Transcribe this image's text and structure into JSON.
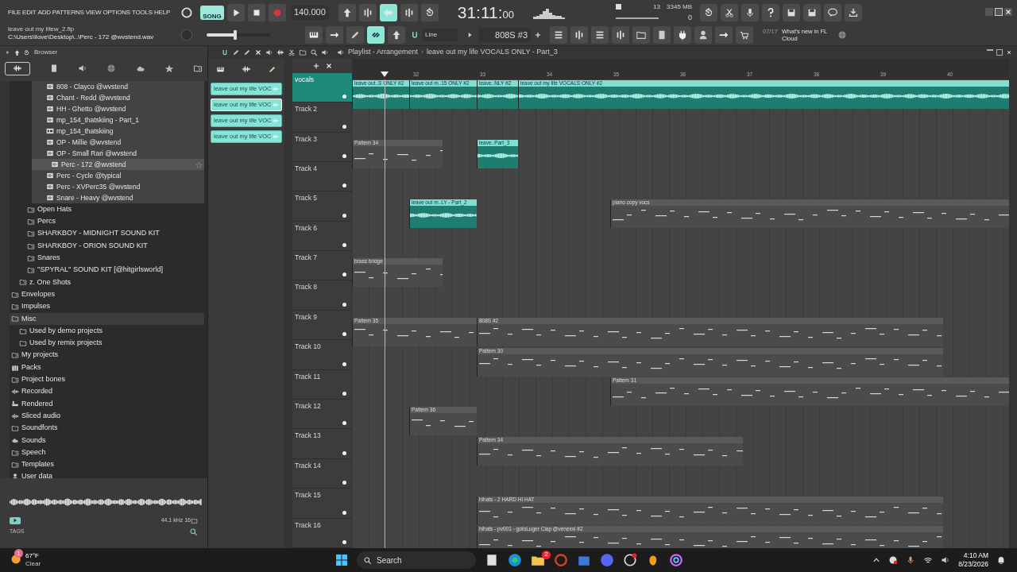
{
  "menu": [
    "FILE",
    "EDIT",
    "ADD",
    "PATTERNS",
    "VIEW",
    "OPTIONS",
    "TOOLS",
    "HELP"
  ],
  "hint": {
    "title": "leave out my lifew_2.flp",
    "path": "C:\\Users\\ilove\\Desktop\\..\\Perc - 172 @wvstend.wav"
  },
  "transport": {
    "mode": "SONG",
    "tempo": "140.000"
  },
  "master_volume": {
    "level": 0.45
  },
  "time": {
    "main": "31:11:",
    "sub": "00"
  },
  "memory": {
    "voices": "13",
    "ram": "3345 MB",
    "cpu": "0"
  },
  "snap": "Line",
  "pattern": "808S #3",
  "news": {
    "count": "07/17",
    "text": "What's new in FL Cloud"
  },
  "browser": {
    "title": "Browser",
    "files": [
      {
        "label": "808 - Clayco @wvstend",
        "kind": "audio",
        "selected": false
      },
      {
        "label": "Chant - Redd @wvstend",
        "kind": "audio",
        "selected": false
      },
      {
        "label": "HH - Ghetto @wvstend",
        "kind": "audio",
        "selected": false
      },
      {
        "label": "mp_154_thatskiing - Part_1",
        "kind": "audio",
        "selected": false
      },
      {
        "label": "mp_154_thatskiing",
        "kind": "mp3",
        "selected": false
      },
      {
        "label": "OP - Millie @wvstend",
        "kind": "audio",
        "selected": false
      },
      {
        "label": "OP - Small Rari @wvstend",
        "kind": "audio",
        "selected": false
      },
      {
        "label": "Perc - 172 @wvstend",
        "kind": "audio",
        "selected": true
      },
      {
        "label": "Perc - Cycle @typical",
        "kind": "audio",
        "selected": false
      },
      {
        "label": "Perc - XVPerc35 @wvstend",
        "kind": "audio",
        "selected": false
      },
      {
        "label": "Snare - Heavy @wvstend",
        "kind": "audio",
        "selected": false
      }
    ],
    "subfolders": [
      "Open Hats",
      "Percs",
      "SHARKBOY - MIDNIGHT SOUND KIT",
      "SHARKBOY - ORION SOUND KIT",
      "Snares",
      "''SPYRAL'' SOUND KIT [@hitgirlsworld]"
    ],
    "outer_folders": [
      "z. One Shots"
    ],
    "items": [
      {
        "label": "Envelopes",
        "kind": "link",
        "highlighted": false
      },
      {
        "label": "Impulses",
        "kind": "link",
        "highlighted": false
      },
      {
        "label": "Misc",
        "kind": "folder",
        "highlighted": true,
        "children": [
          {
            "label": "Used by demo projects",
            "kind": "folder",
            "highlighted": false
          },
          {
            "label": "Used by remix projects",
            "kind": "folder",
            "highlighted": false
          }
        ]
      },
      {
        "label": "My projects",
        "kind": "link",
        "highlighted": false
      },
      {
        "label": "Packs",
        "kind": "packs",
        "highlighted": false
      },
      {
        "label": "Project bones",
        "kind": "link",
        "highlighted": false
      },
      {
        "label": "Recorded",
        "kind": "wave",
        "highlighted": false
      },
      {
        "label": "Rendered",
        "kind": "render",
        "highlighted": false
      },
      {
        "label": "Sliced audio",
        "kind": "wave",
        "highlighted": false
      },
      {
        "label": "Soundfonts",
        "kind": "folder",
        "highlighted": false
      },
      {
        "label": "Sounds",
        "kind": "cloud",
        "highlighted": false
      },
      {
        "label": "Speech",
        "kind": "link",
        "highlighted": false
      },
      {
        "label": "Templates",
        "kind": "link",
        "highlighted": false
      },
      {
        "label": "User data",
        "kind": "user",
        "highlighted": false
      }
    ],
    "sample_info": "44.1 kHz 16",
    "tags_label": "TAGS"
  },
  "playlist": {
    "title": "Playlist - Arrangement",
    "separator": "›",
    "pattern_name": "leave out my life VOCALS ONLY - Part_3",
    "picker": [
      {
        "label": "leave out my life VOC",
        "selected": false
      },
      {
        "label": "leave out my life VOC",
        "selected": true
      },
      {
        "label": "leave out my life VOC",
        "selected": false
      },
      {
        "label": "leave out my life VOC",
        "selected": false
      }
    ],
    "bars": [
      "32",
      "33",
      "34",
      "35",
      "36",
      "37",
      "38",
      "39",
      "40"
    ],
    "tracks": [
      {
        "name": "vocals",
        "color": "#1f8a7a",
        "clips": [
          {
            "kind": "audio",
            "label": "leave out..S ONLY #2"
          },
          {
            "kind": "audio",
            "label": "leave out m..15 ONLY #2"
          },
          {
            "kind": "audio",
            "label": "leave..NLY #2"
          },
          {
            "kind": "audio",
            "label": "leave out my life VOCALS ONLY #2"
          }
        ]
      },
      {
        "name": "Track 2",
        "color": "#3c3c3c"
      },
      {
        "name": "Track 3",
        "color": "#3c3c3c",
        "clips": [
          {
            "kind": "pattern",
            "label": "Pattern 34"
          },
          {
            "kind": "audio",
            "label": "leave..Part_3"
          }
        ]
      },
      {
        "name": "Track 4",
        "color": "#3c3c3c"
      },
      {
        "name": "Track 5",
        "color": "#3c3c3c",
        "clips": [
          {
            "kind": "audio",
            "label": "leave out m..LY - Part_2"
          },
          {
            "kind": "pattern",
            "label": "piano copy vocs"
          }
        ]
      },
      {
        "name": "Track 6",
        "color": "#3c3c3c"
      },
      {
        "name": "Track 7",
        "color": "#3c3c3c",
        "clips": [
          {
            "kind": "pattern",
            "label": "brass bridge"
          }
        ]
      },
      {
        "name": "Track 8",
        "color": "#3c3c3c"
      },
      {
        "name": "Track 9",
        "color": "#3c3c3c",
        "clips": [
          {
            "kind": "pattern",
            "label": "Pattern 35"
          },
          {
            "kind": "pattern",
            "label": "808S #2"
          }
        ]
      },
      {
        "name": "Track 10",
        "color": "#3c3c3c",
        "clips": [
          {
            "kind": "pattern",
            "label": "Pattern 30"
          }
        ]
      },
      {
        "name": "Track 11",
        "color": "#3c3c3c",
        "clips": [
          {
            "kind": "pattern",
            "label": "Pattern 31"
          }
        ]
      },
      {
        "name": "Track 12",
        "color": "#3c3c3c",
        "clips": [
          {
            "kind": "pattern",
            "label": "Pattern 36"
          }
        ]
      },
      {
        "name": "Track 13",
        "color": "#3c3c3c",
        "clips": [
          {
            "kind": "pattern",
            "label": "Pattern 34"
          }
        ]
      },
      {
        "name": "Track 14",
        "color": "#3c3c3c"
      },
      {
        "name": "Track 15",
        "color": "#3c3c3c",
        "clips": [
          {
            "kind": "pattern",
            "label": "hihats - 2 HARD HI HAT"
          }
        ]
      },
      {
        "name": "Track 16",
        "color": "#3c3c3c",
        "clips": [
          {
            "kind": "pattern",
            "label": "hihats - pv001 - gotoLuger Clap @venexxi #2"
          }
        ]
      }
    ]
  },
  "taskbar": {
    "weather": {
      "temp": "67°F",
      "condition": "Clear",
      "badge": "1"
    },
    "search": "Search",
    "chat_badge": "2",
    "time": "4:10 AM",
    "date": "8/23/2026"
  }
}
